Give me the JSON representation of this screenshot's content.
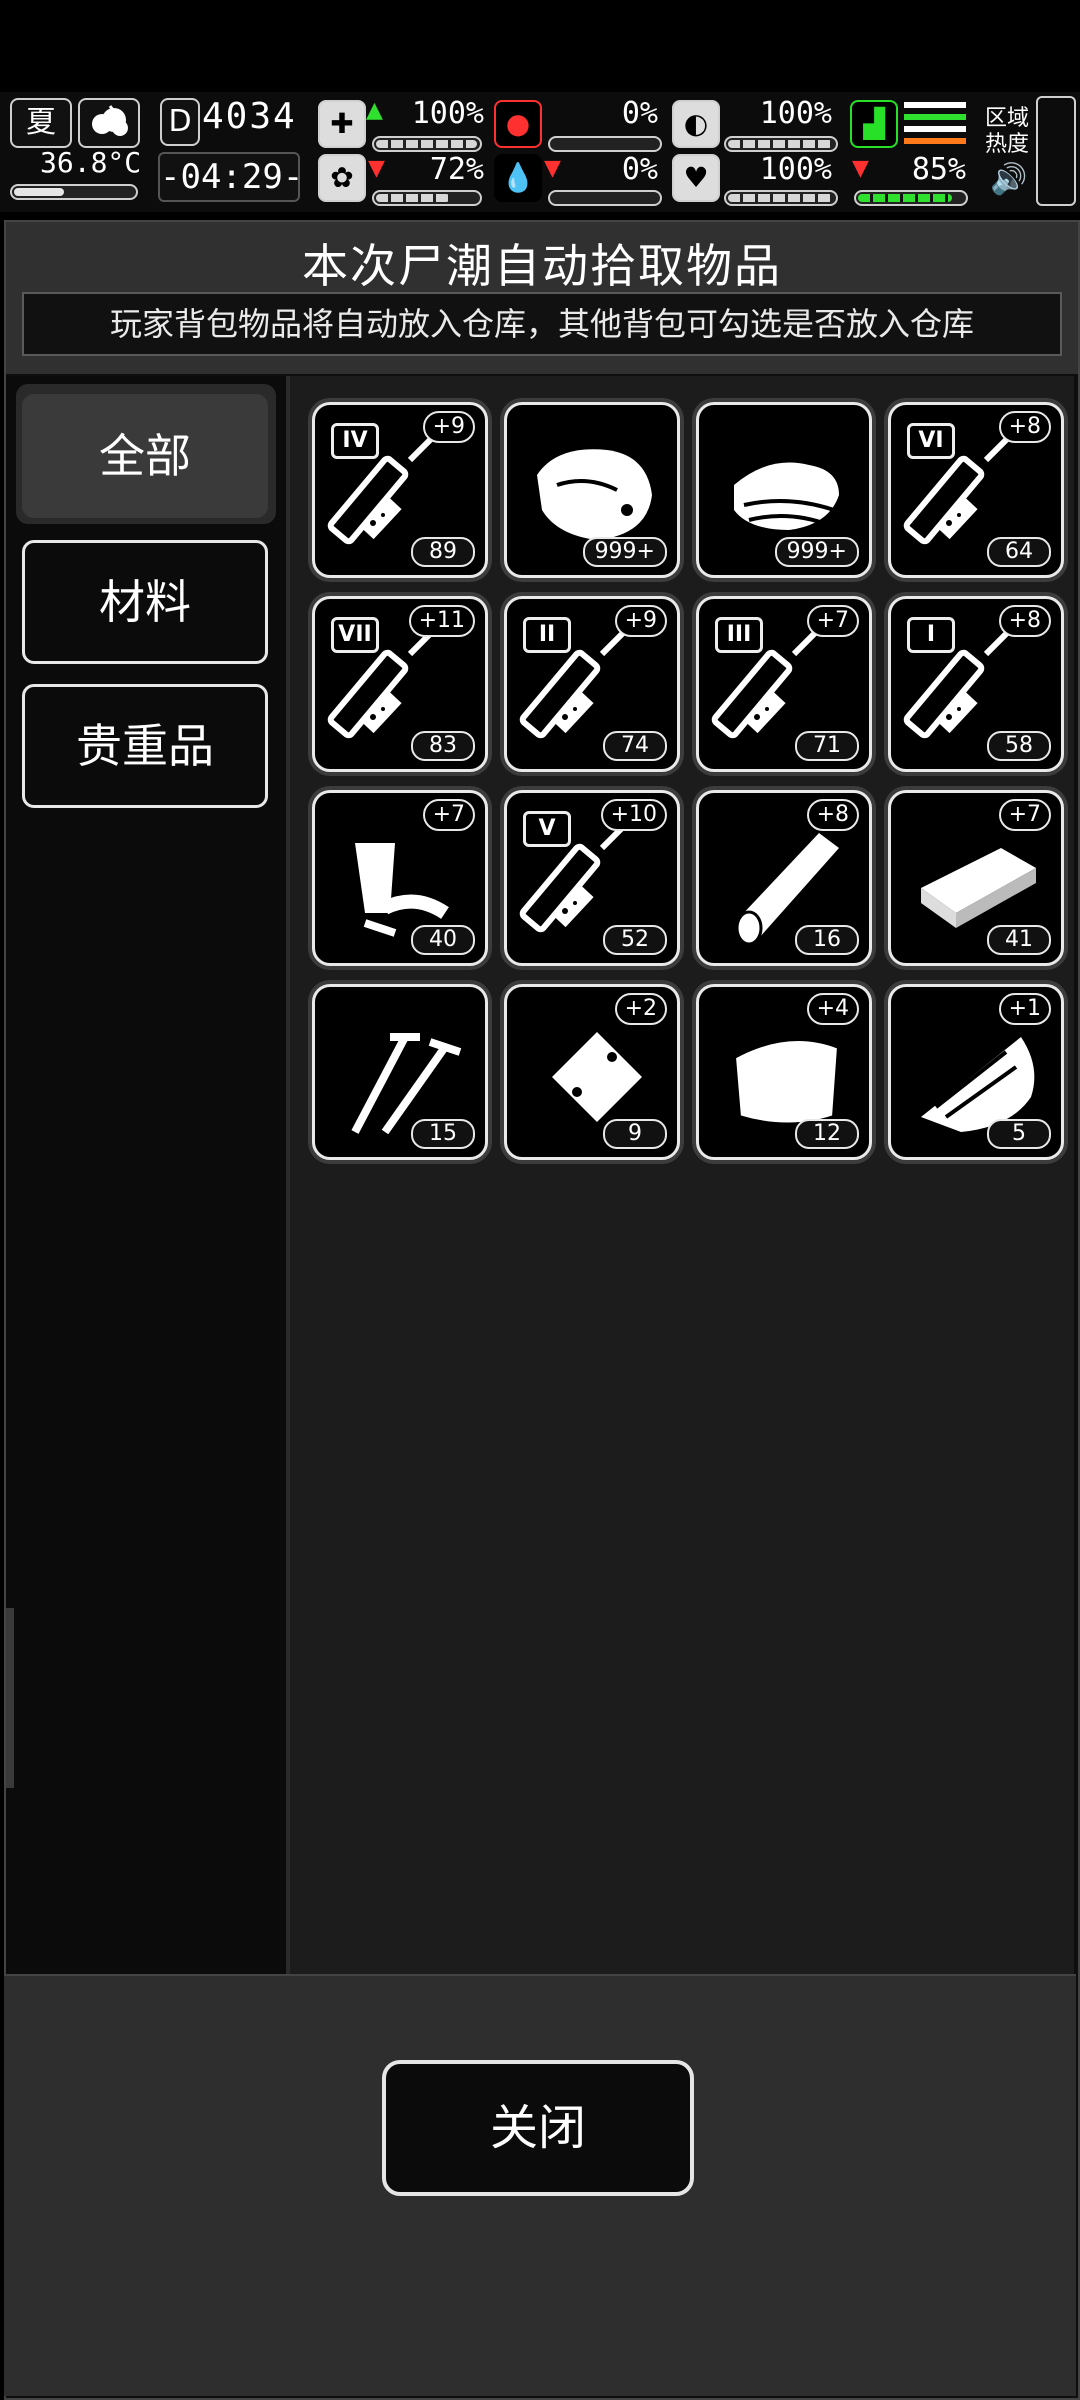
{
  "hud": {
    "season": "夏",
    "temperature": "36.8°C",
    "day_counter": "4034",
    "clock": "-04:29-",
    "stats": [
      {
        "name": "medkit",
        "value": "100%",
        "trend": "up"
      },
      {
        "name": "stomach",
        "value": "0%",
        "trend": "none"
      },
      {
        "name": "pill",
        "value": "100%",
        "trend": "none"
      },
      {
        "name": "brain",
        "value": "72%",
        "trend": "down"
      },
      {
        "name": "blood",
        "value": "0%",
        "trend": "down"
      },
      {
        "name": "heart",
        "value": "100%",
        "trend": "none"
      },
      {
        "name": "stamina",
        "value": "85%",
        "trend": "down"
      }
    ],
    "zone_label_line1": "区域",
    "zone_label_line2": "热度"
  },
  "panel": {
    "title": "本次尸潮自动拾取物品",
    "notice": "玩家背包物品将自动放入仓库，其他背包可勾选是否放入仓库"
  },
  "tabs": [
    {
      "label": "全部",
      "active": true
    },
    {
      "label": "材料",
      "active": false
    },
    {
      "label": "贵重品",
      "active": false
    }
  ],
  "items": [
    {
      "icon": "syringe-icon",
      "grade": "IV",
      "bonus": "+9",
      "count": "89"
    },
    {
      "icon": "meat-icon",
      "grade": "",
      "bonus": "",
      "count": "999+"
    },
    {
      "icon": "cloth-icon",
      "grade": "",
      "bonus": "",
      "count": "999+"
    },
    {
      "icon": "syringe-icon",
      "grade": "VI",
      "bonus": "+8",
      "count": "64"
    },
    {
      "icon": "syringe-icon",
      "grade": "VII",
      "bonus": "+11",
      "count": "83"
    },
    {
      "icon": "syringe-icon",
      "grade": "II",
      "bonus": "+9",
      "count": "74"
    },
    {
      "icon": "syringe-icon",
      "grade": "III",
      "bonus": "+7",
      "count": "71"
    },
    {
      "icon": "syringe-icon",
      "grade": "I",
      "bonus": "+8",
      "count": "58"
    },
    {
      "icon": "pipes-icon",
      "grade": "",
      "bonus": "+7",
      "count": "40"
    },
    {
      "icon": "syringe-icon",
      "grade": "V",
      "bonus": "+10",
      "count": "52"
    },
    {
      "icon": "wood-log-icon",
      "grade": "",
      "bonus": "+8",
      "count": "16"
    },
    {
      "icon": "plank-icon",
      "grade": "",
      "bonus": "+7",
      "count": "41"
    },
    {
      "icon": "nails-icon",
      "grade": "",
      "bonus": "",
      "count": "15"
    },
    {
      "icon": "pouch-icon",
      "grade": "",
      "bonus": "+2",
      "count": "9"
    },
    {
      "icon": "leather-icon",
      "grade": "",
      "bonus": "+4",
      "count": "12"
    },
    {
      "icon": "scrap-icon",
      "grade": "",
      "bonus": "+1",
      "count": "5"
    }
  ],
  "footer": {
    "close_label": "关闭"
  }
}
